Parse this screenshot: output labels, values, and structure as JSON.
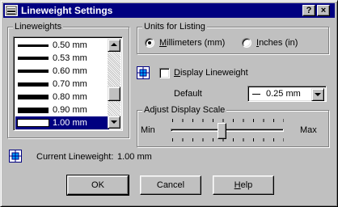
{
  "window": {
    "title": "Lineweight Settings",
    "help_button": "?",
    "close_button": "×"
  },
  "lineweights": {
    "label": "Lineweights",
    "items": [
      {
        "label": "0.50 mm",
        "thickness": 3,
        "selected": false
      },
      {
        "label": "0.53 mm",
        "thickness": 4,
        "selected": false
      },
      {
        "label": "0.60 mm",
        "thickness": 4,
        "selected": false
      },
      {
        "label": "0.70 mm",
        "thickness": 5,
        "selected": false
      },
      {
        "label": "0.80 mm",
        "thickness": 6,
        "selected": false
      },
      {
        "label": "0.90 mm",
        "thickness": 7,
        "selected": false
      },
      {
        "label": "1.00 mm",
        "thickness": 8,
        "selected": true
      }
    ]
  },
  "units": {
    "label": "Units for Listing",
    "millimeters_label": "Millimeters (mm)",
    "inches_label": "Inches (in)",
    "selected": "millimeters"
  },
  "display_lineweight": {
    "label": "Display Lineweight",
    "checked": false
  },
  "default": {
    "label": "Default",
    "value": "0.25 mm"
  },
  "display_scale": {
    "label": "Adjust Display Scale",
    "min_label": "Min",
    "max_label": "Max",
    "position_fraction": 0.45
  },
  "current_lineweight": {
    "label": "Current Lineweight:",
    "value": "1.00 mm"
  },
  "buttons": {
    "ok": "OK",
    "cancel": "Cancel",
    "help": "Help"
  },
  "colors": {
    "titlebar": "#000080",
    "selection": "#000080",
    "face": "#c0c0c0"
  },
  "icons": {
    "title": "autocad-app-icon",
    "display": "lineweight-display-icon",
    "current": "lineweight-display-icon"
  }
}
